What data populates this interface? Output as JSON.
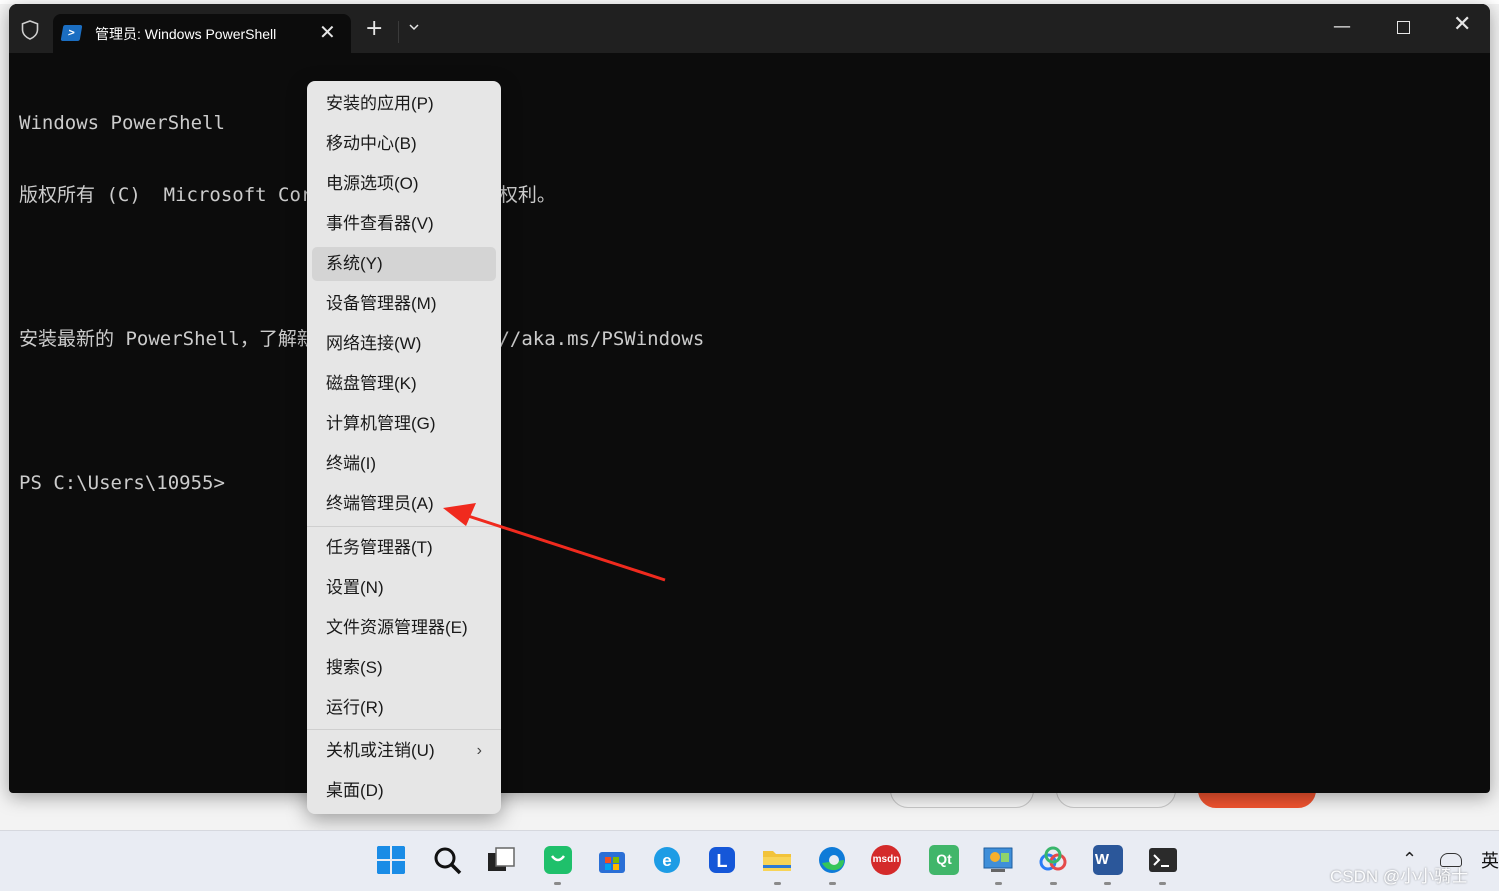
{
  "window": {
    "tab_title": "管理员: Windows PowerShell",
    "tab_icon": "powershell-icon",
    "new_tab_label": "+",
    "close_tab_label": "✕"
  },
  "console_lines": [
    "Windows PowerShell",
    "版权所有 (C)  Microsoft Corporation。保留所有权利。",
    "",
    "安装最新的 PowerShell，了解新功能和改进！https://aka.ms/PSWindows",
    "",
    "PS C:\\Users\\10955>"
  ],
  "context_menu": {
    "items": [
      {
        "label": "安装的应用(P)"
      },
      {
        "label": "移动中心(B)"
      },
      {
        "label": "电源选项(O)"
      },
      {
        "label": "事件查看器(V)"
      },
      {
        "label": "系统(Y)"
      },
      {
        "label": "设备管理器(M)"
      },
      {
        "label": "网络连接(W)"
      },
      {
        "label": "磁盘管理(K)"
      },
      {
        "label": "计算机管理(G)"
      },
      {
        "label": "终端(I)"
      },
      {
        "label": "终端管理员(A)"
      },
      {
        "label": "任务管理器(T)"
      },
      {
        "label": "设置(N)"
      },
      {
        "label": "文件资源管理器(E)"
      },
      {
        "label": "搜索(S)"
      },
      {
        "label": "运行(R)"
      },
      {
        "label": "关机或注销(U)"
      },
      {
        "label": "桌面(D)"
      }
    ],
    "hovered": "系统(Y)",
    "annotation_color": "#f02a1e"
  },
  "taskbar": {
    "icons": [
      "windows-start-icon",
      "search-icon",
      "task-view-icon",
      "wechat-icon",
      "microsoft-store-icon",
      "ie-icon",
      "lenovo-icon",
      "file-explorer-icon",
      "edge-icon",
      "msdn-icon",
      "qt-icon",
      "control-panel-icon",
      "baidu-netdisk-icon",
      "word-icon",
      "terminal-icon"
    ],
    "msdn_label": "msdn",
    "qt_label": "Qt",
    "word_label": "W",
    "ime_label": "英",
    "watermark": "CSDN @小小骑士"
  },
  "colors": {
    "terminal_bg": "#0c0c0c",
    "titlebar_bg": "#202020",
    "menu_bg": "#e6e6e6",
    "accent_arrow": "#f02a1e"
  }
}
